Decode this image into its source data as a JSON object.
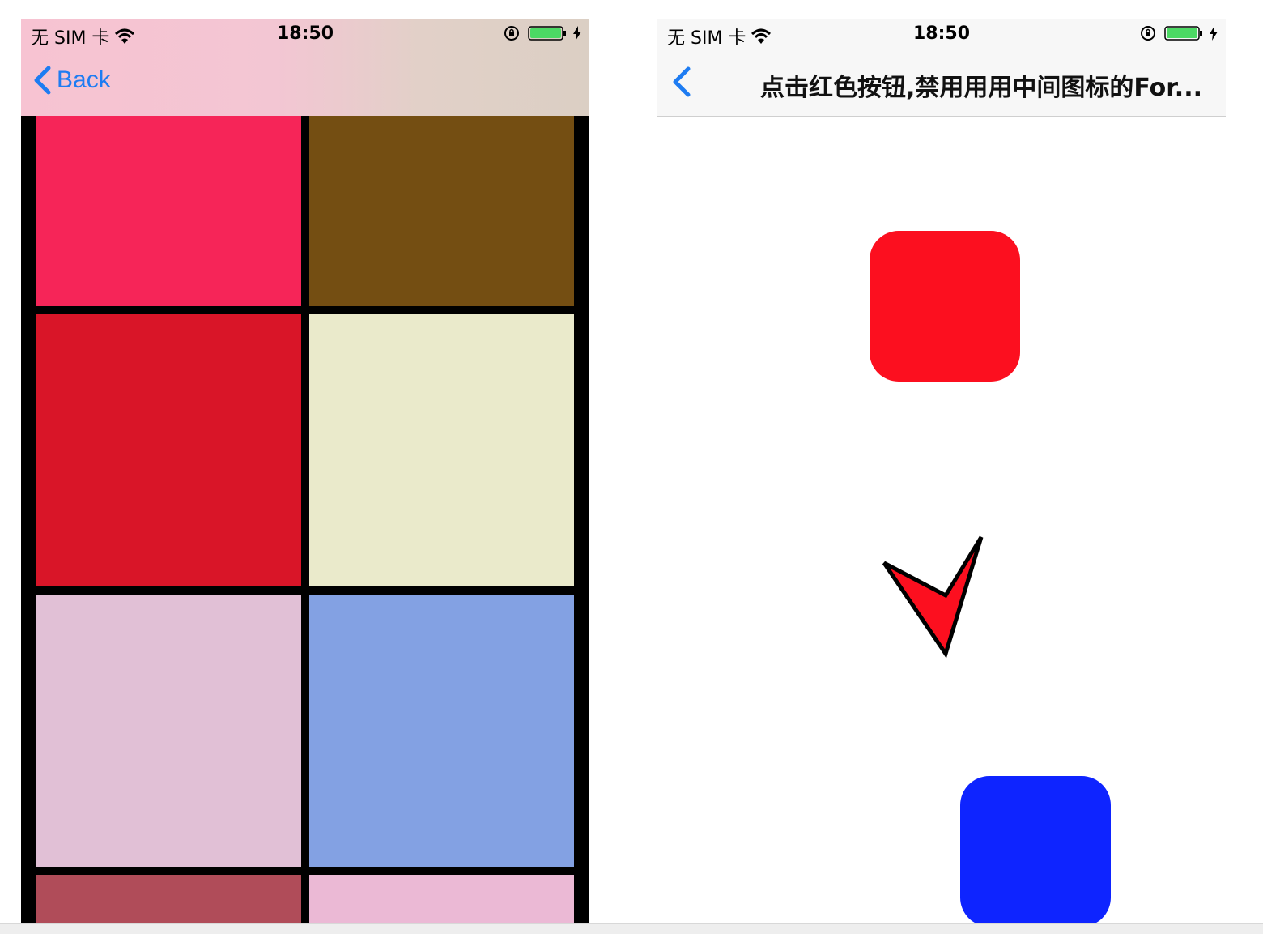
{
  "left_phone": {
    "status": {
      "carrier": "无 SIM 卡",
      "time": "18:50"
    },
    "nav": {
      "back_label": "Back"
    },
    "grid_colors": [
      "#f62558",
      "#744e12",
      "#d91528",
      "#eaeacb",
      "#e1c0d6",
      "#83a1e3",
      "#b04c59",
      "#ebb9d5"
    ]
  },
  "right_phone": {
    "status": {
      "carrier": "无 SIM 卡",
      "time": "18:50"
    },
    "nav": {
      "title": "点击红色按钮,禁用用用中间图标的For..."
    },
    "colors": {
      "red": "#fc0f1f",
      "blue": "#0e24ff",
      "accent": "#1e7cf2"
    }
  }
}
